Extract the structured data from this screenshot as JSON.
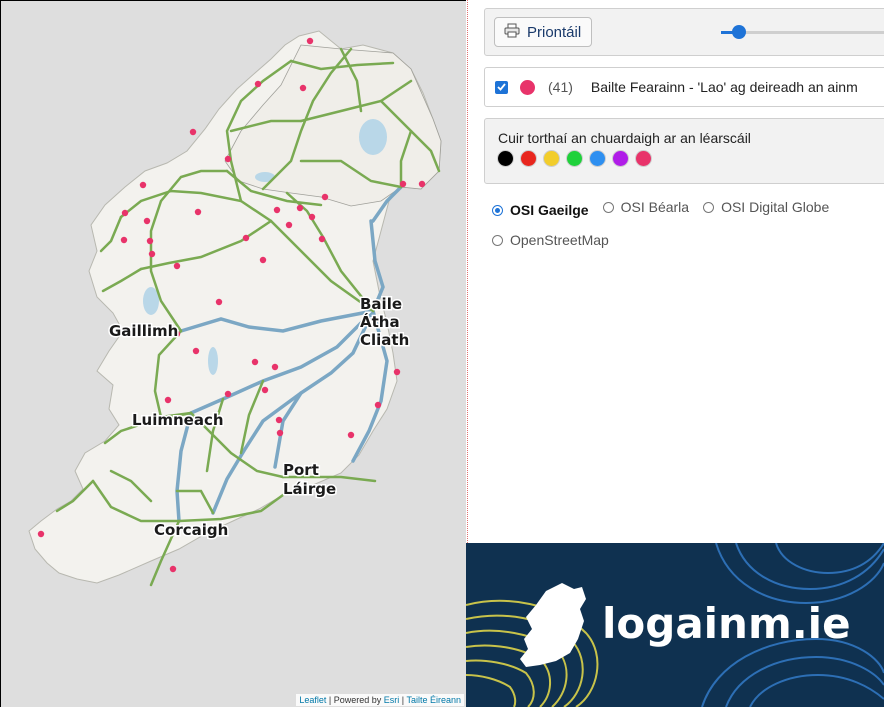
{
  "map": {
    "city_labels": [
      "Baile",
      "Átha",
      "Cliath",
      "Gaillimh",
      "Luimneach",
      "Port",
      "Láirge",
      "Corcaigh"
    ],
    "attribution": {
      "leaflet": "Leaflet",
      "sep1": " | Powered by ",
      "esri": "Esri",
      "sep2": " | ",
      "tailte": "Tailte Éireann"
    },
    "marker_color": "#e8336a",
    "road_color": "#7aaa52",
    "river_color": "#7ba7c4"
  },
  "toolbar": {
    "print_label": "Priontáil",
    "print_icon": "printer-icon",
    "opacity": 0.09
  },
  "layer": {
    "count": "(41)",
    "name": "Bailte Fearainn - 'Lao' ag deireadh an ainm",
    "color": "#e8336a",
    "checked": true
  },
  "search": {
    "label": "Cuir torthaí an chuardaigh ar an léarscáil",
    "colors": [
      "#000000",
      "#e8261e",
      "#f2cd2b",
      "#1fd13b",
      "#2e8ff0",
      "#b01de8",
      "#e8336a"
    ]
  },
  "basemaps": [
    {
      "label": "OSI Gaeilge",
      "selected": true
    },
    {
      "label": "OSI Béarla",
      "selected": false
    },
    {
      "label": "OSI Digital Globe",
      "selected": false
    },
    {
      "label": "OpenStreetMap",
      "selected": false
    }
  ],
  "banner": {
    "logo": "logainm.ie",
    "bg": "#0f3150",
    "accent": "#c8c34a"
  }
}
